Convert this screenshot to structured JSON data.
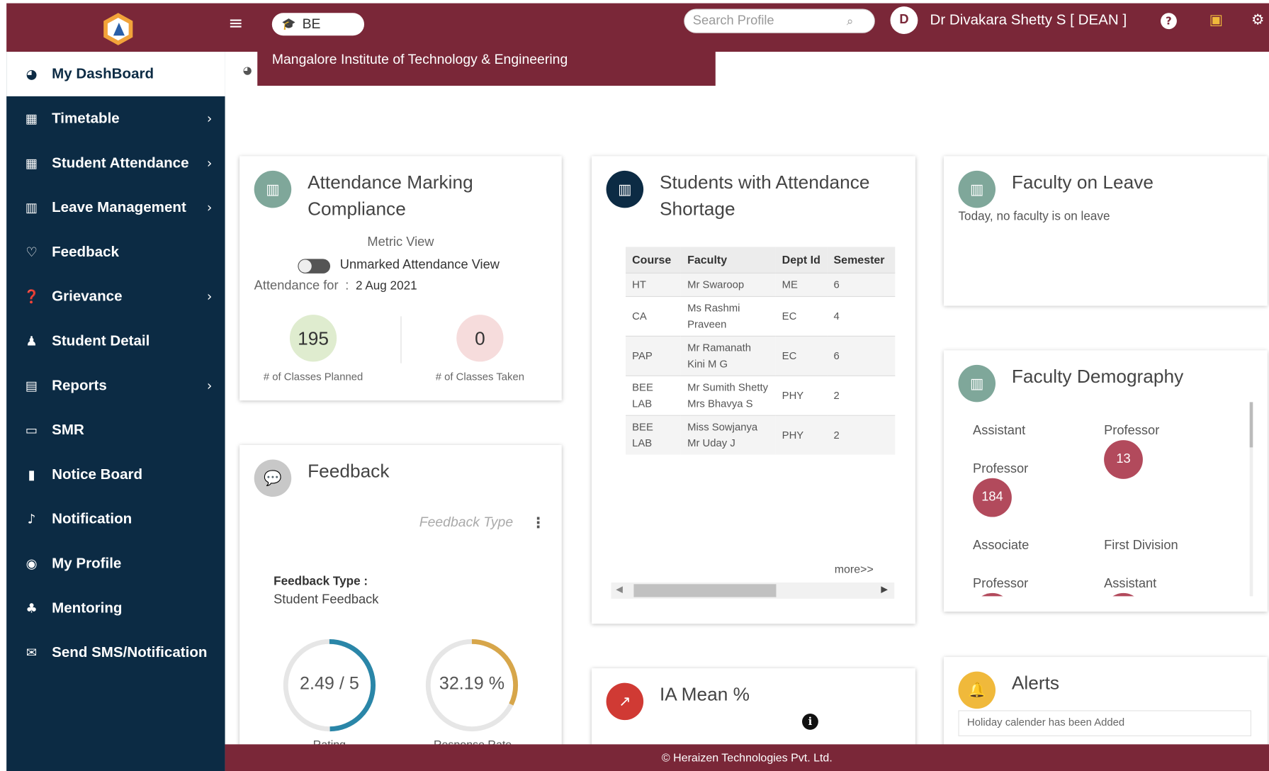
{
  "colors": {
    "topbar": "#7a2738",
    "sidebar": "#0c2b44",
    "accent_ring": "#2a86a8",
    "gold_ring": "#d7a64a",
    "badge": "#b24a5c"
  },
  "header": {
    "menu_icon": "hamburger-icon",
    "institution_select_value": "BE",
    "search_placeholder": "Search Profile",
    "avatar_initial": "D",
    "user_name": "Dr Divakara Shetty S [ DEAN ]",
    "help_icon_glyph": "?",
    "institution_name": "Mangalore Institute of Technology & Engineering"
  },
  "sidebar": {
    "items": [
      {
        "label": "My DashBoard",
        "icon": "dashboard-icon",
        "glyph": "◕",
        "chevron": ""
      },
      {
        "label": "Timetable",
        "icon": "calendar-icon",
        "glyph": "▦",
        "chevron": "›"
      },
      {
        "label": "Student Attendance",
        "icon": "calendar-icon",
        "glyph": "▦",
        "chevron": "›"
      },
      {
        "label": "Leave Management",
        "icon": "bar-chart-icon",
        "glyph": "▥",
        "chevron": "›"
      },
      {
        "label": "Feedback",
        "icon": "thumbs-up-icon",
        "glyph": "♡",
        "chevron": ""
      },
      {
        "label": "Grievance",
        "icon": "question-icon",
        "glyph": "❓",
        "chevron": "›"
      },
      {
        "label": "Student Detail",
        "icon": "user-icon",
        "glyph": "♟",
        "chevron": ""
      },
      {
        "label": "Reports",
        "icon": "report-icon",
        "glyph": "▤",
        "chevron": "›"
      },
      {
        "label": "SMR",
        "icon": "id-card-icon",
        "glyph": "▭",
        "chevron": ""
      },
      {
        "label": "Notice Board",
        "icon": "file-icon",
        "glyph": "▮",
        "chevron": ""
      },
      {
        "label": "Notification",
        "icon": "bell-icon",
        "glyph": "♪",
        "chevron": ""
      },
      {
        "label": "My Profile",
        "icon": "profile-icon",
        "glyph": "◉",
        "chevron": ""
      },
      {
        "label": "Mentoring",
        "icon": "users-icon",
        "glyph": "♣",
        "chevron": ""
      },
      {
        "label": "Send SMS/Notification",
        "icon": "chat-icon",
        "glyph": "✉",
        "chevron": ""
      }
    ]
  },
  "attendance_compliance": {
    "title": "Attendance Marking Compliance",
    "view_label": "Metric View",
    "toggle_label": "Unmarked Attendance View",
    "date_label": "Attendance for",
    "date_sep": ":",
    "date_value": "2 Aug 2021",
    "planned_value": "195",
    "planned_label": "# of Classes Planned",
    "taken_value": "0",
    "taken_label": "# of Classes Taken"
  },
  "shortage": {
    "title": "Students with Attendance Shortage",
    "columns": [
      "Course",
      "Faculty",
      "Dept Id",
      "Semester"
    ],
    "rows": [
      [
        "HT",
        "Mr Swaroop",
        "ME",
        "6"
      ],
      [
        "CA",
        "Ms Rashmi Praveen",
        "EC",
        "4"
      ],
      [
        "PAP",
        "Mr Ramanath Kini M G",
        "EC",
        "6"
      ],
      [
        "BEE LAB",
        "Mr Sumith Shetty Mrs Bhavya S",
        "PHY",
        "2"
      ],
      [
        "BEE LAB",
        "Miss Sowjanya Mr Uday J",
        "PHY",
        "2"
      ]
    ],
    "more_link": "more>>"
  },
  "faculty_leave": {
    "title": "Faculty on Leave",
    "message": "Today, no faculty is on leave"
  },
  "demography": {
    "title": "Faculty Demography",
    "items": [
      {
        "label": "Assistant Professor",
        "count": "184"
      },
      {
        "label": "Professor",
        "count": "13"
      },
      {
        "label": "Associate Professor",
        "count": ""
      },
      {
        "label": "First Division Assistant",
        "count": ""
      }
    ]
  },
  "feedback": {
    "title": "Feedback",
    "type_placeholder": "Feedback Type",
    "type_label": "Feedback Type :",
    "type_value": "Student Feedback",
    "rating_value": "2.49 / 5",
    "rating_fraction": 0.498,
    "rating_label": "Rating",
    "response_value": "32.19 %",
    "response_fraction": 0.3219,
    "response_label": "Response Rate"
  },
  "ia_mean": {
    "title": "IA Mean %"
  },
  "alerts": {
    "title": "Alerts",
    "items": [
      "Holiday calender has been Added"
    ]
  },
  "footer": {
    "text": "© Heraizen Technologies Pvt. Ltd."
  }
}
